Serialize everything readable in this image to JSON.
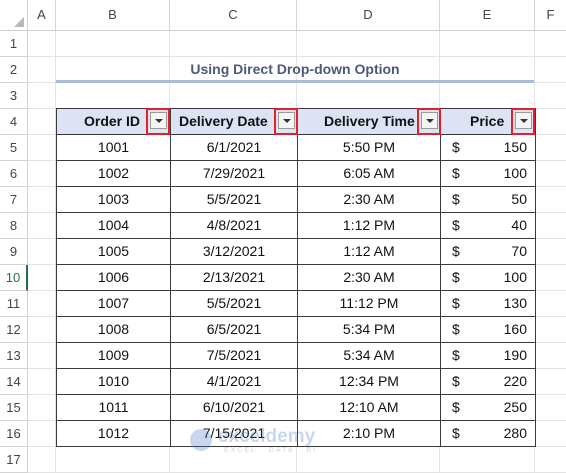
{
  "sheet": {
    "columns": [
      "A",
      "B",
      "C",
      "D",
      "E",
      "F"
    ],
    "rows": [
      "1",
      "2",
      "3",
      "4",
      "5",
      "6",
      "7",
      "8",
      "9",
      "10",
      "11",
      "12",
      "13",
      "14",
      "15",
      "16",
      "17"
    ],
    "active_row": "10"
  },
  "title": "Using Direct Drop-down Option",
  "table": {
    "headers": [
      "Order ID",
      "Delivery Date",
      "Delivery Time",
      "Price"
    ],
    "currency_symbol": "$",
    "rows": [
      {
        "order_id": "1001",
        "date": "6/1/2021",
        "time": "5:50 PM",
        "price": "150"
      },
      {
        "order_id": "1002",
        "date": "7/29/2021",
        "time": "6:05 AM",
        "price": "100"
      },
      {
        "order_id": "1003",
        "date": "5/5/2021",
        "time": "2:30 AM",
        "price": "50"
      },
      {
        "order_id": "1004",
        "date": "4/8/2021",
        "time": "1:12 PM",
        "price": "40"
      },
      {
        "order_id": "1005",
        "date": "3/12/2021",
        "time": "1:12 AM",
        "price": "70"
      },
      {
        "order_id": "1006",
        "date": "2/13/2021",
        "time": "2:30 AM",
        "price": "100"
      },
      {
        "order_id": "1007",
        "date": "5/5/2021",
        "time": "11:12 PM",
        "price": "130"
      },
      {
        "order_id": "1008",
        "date": "6/5/2021",
        "time": "5:34 PM",
        "price": "160"
      },
      {
        "order_id": "1009",
        "date": "7/5/2021",
        "time": "5:34 AM",
        "price": "190"
      },
      {
        "order_id": "1010",
        "date": "4/1/2021",
        "time": "12:34 PM",
        "price": "220"
      },
      {
        "order_id": "1011",
        "date": "6/10/2021",
        "time": "12:10 AM",
        "price": "250"
      },
      {
        "order_id": "1012",
        "date": "7/15/2021",
        "time": "2:10 PM",
        "price": "280"
      }
    ]
  },
  "watermark": {
    "name": "exceldemy",
    "tagline": "EXCEL · DATA · BI"
  },
  "colors": {
    "header_fill": "#dde3f3",
    "title_text": "#4a5a78",
    "highlight_border": "#e0202a",
    "active_row_accent": "#217346"
  },
  "icons": {
    "dropdown": "filter-dropdown-icon"
  }
}
